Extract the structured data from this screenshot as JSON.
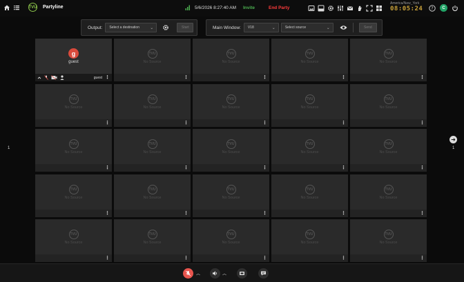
{
  "app": {
    "title": "Partyline",
    "logo_text": "TVU"
  },
  "header": {
    "datetime": "5/6/2026 8:27:40 AM",
    "invite_label": "Invite",
    "end_party_label": "End Party",
    "timezone": "America/New_York",
    "clock_time": "08:05:24",
    "user_initial": "C"
  },
  "output": {
    "label": "Output:",
    "destination_placeholder": "Select a destination",
    "start_label": "Start"
  },
  "main_window": {
    "label": "Main Window:",
    "view_value": "V18",
    "source_placeholder": "Select source",
    "send_label": "Send"
  },
  "grid": {
    "empty_label": "No Source",
    "placeholder_logo": "TVU",
    "active_tile": {
      "initial": "g",
      "name": "guest",
      "footer_user": "guest"
    }
  },
  "pager": {
    "left_page": "1",
    "right_page": "1"
  },
  "colors": {
    "accent": "#8bc34a",
    "end": "#ff3b3b",
    "invite": "#4caf50",
    "guest_avatar": "#d94a3c"
  }
}
